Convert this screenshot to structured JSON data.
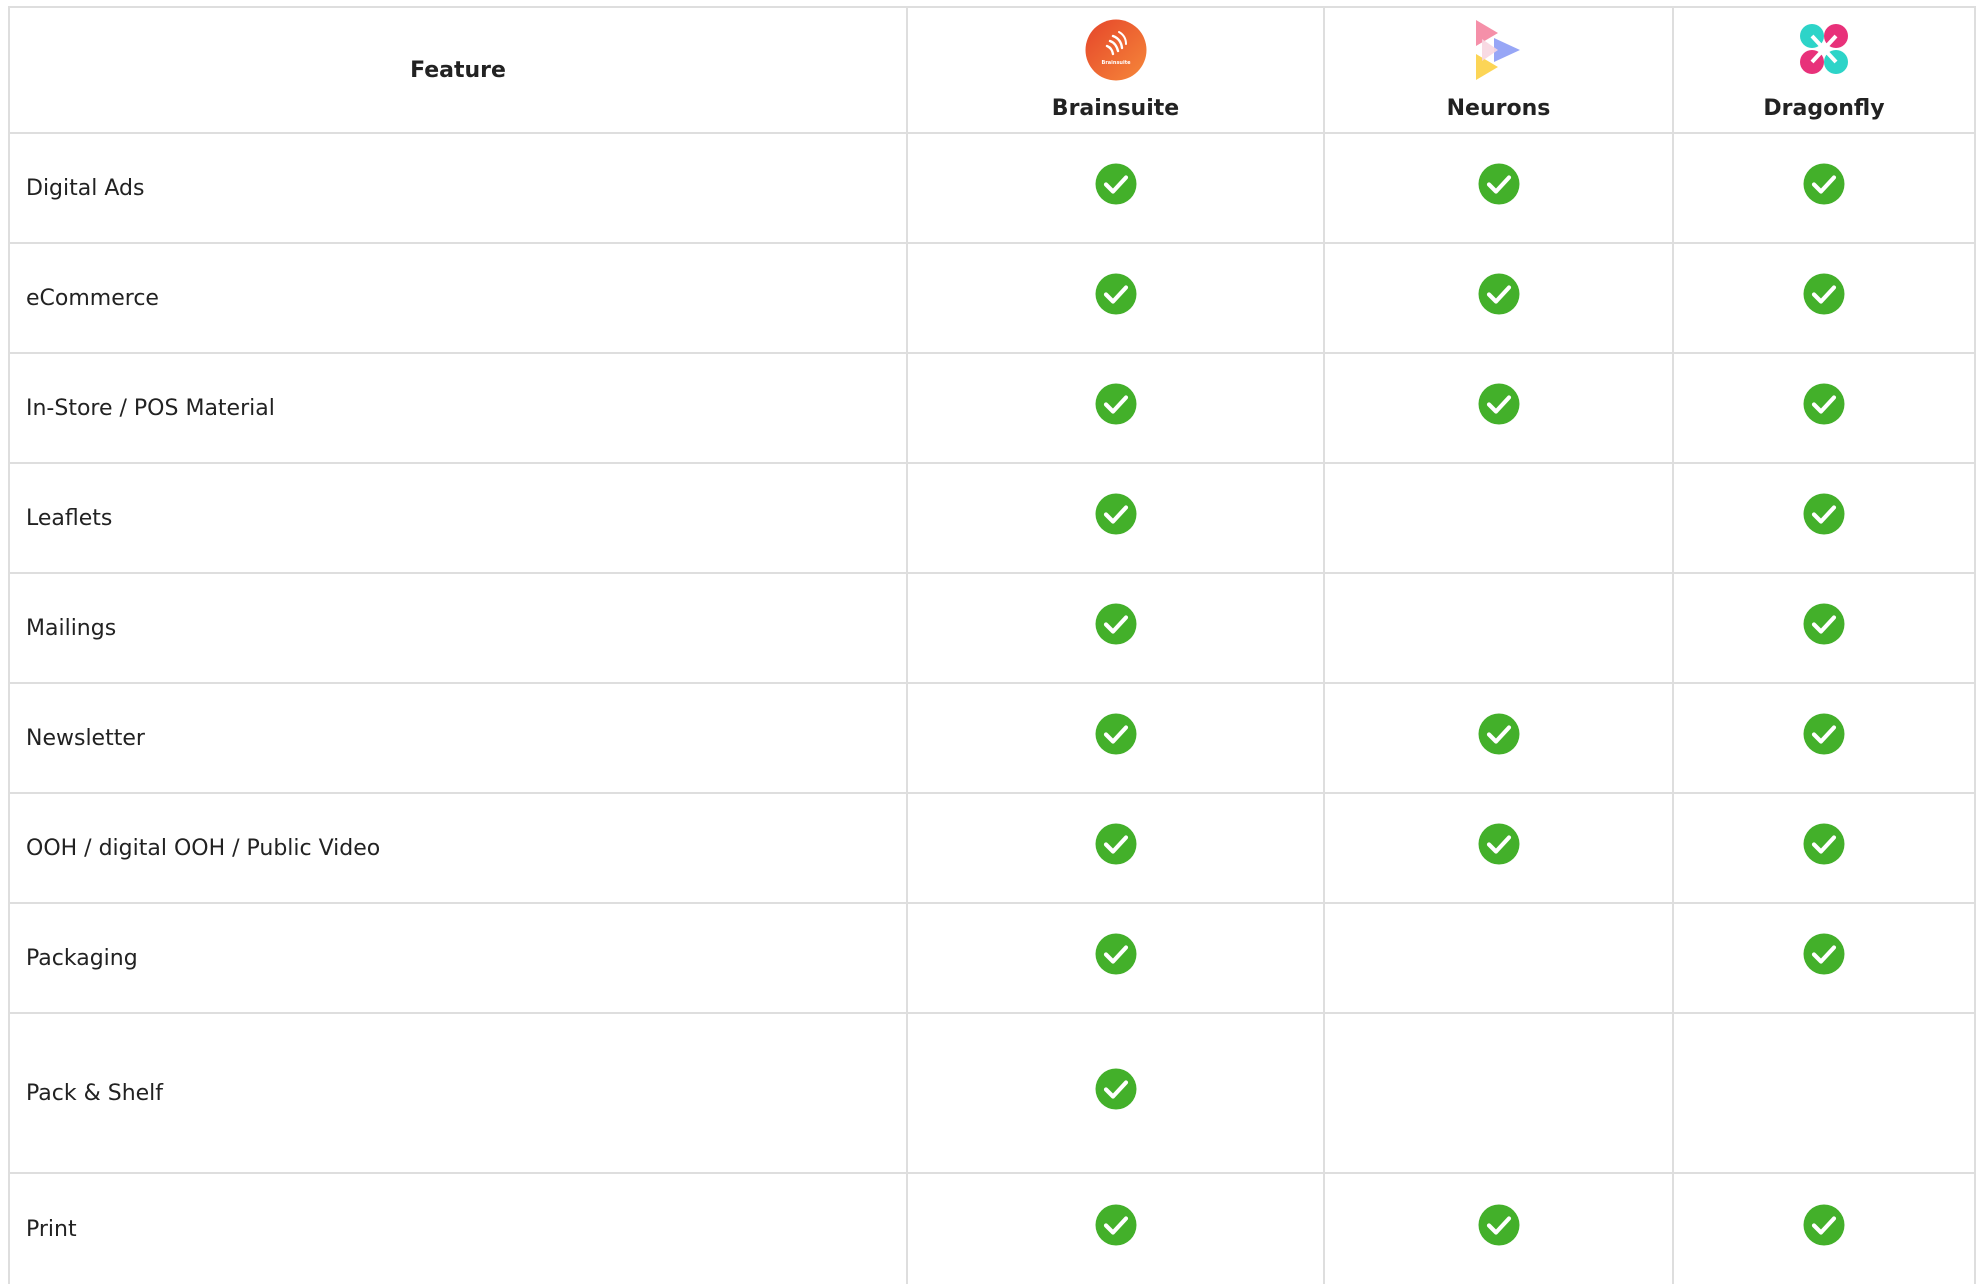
{
  "header": {
    "feature_label": "Feature",
    "vendors": [
      {
        "name": "Brainsuite",
        "logo_icon": "brainsuite-logo-icon",
        "logo_text": "Brainsuite",
        "color": "#ef6a2b"
      },
      {
        "name": "Neurons",
        "logo_icon": "neurons-logo-icon",
        "color": "#8c9cf5"
      },
      {
        "name": "Dragonfly",
        "logo_icon": "dragonfly-logo-icon",
        "color": "#e8317a"
      }
    ]
  },
  "check_color": "#43b02a",
  "check_icon": "check-circle-icon",
  "rows": [
    {
      "feature": "Digital Ads",
      "marks": [
        true,
        true,
        true
      ]
    },
    {
      "feature": "eCommerce",
      "marks": [
        true,
        true,
        true
      ]
    },
    {
      "feature": "In-Store / POS Material",
      "marks": [
        true,
        true,
        true
      ]
    },
    {
      "feature": "Leaflets",
      "marks": [
        true,
        false,
        true
      ]
    },
    {
      "feature": "Mailings",
      "marks": [
        true,
        false,
        true
      ]
    },
    {
      "feature": "Newsletter",
      "marks": [
        true,
        true,
        true
      ]
    },
    {
      "feature": "OOH / digital OOH / Public Video",
      "marks": [
        true,
        true,
        true
      ]
    },
    {
      "feature": "Packaging",
      "marks": [
        true,
        false,
        true
      ]
    },
    {
      "feature": "Pack & Shelf",
      "marks": [
        true,
        false,
        false
      ]
    },
    {
      "feature": "Print",
      "marks": [
        true,
        true,
        true
      ]
    }
  ]
}
